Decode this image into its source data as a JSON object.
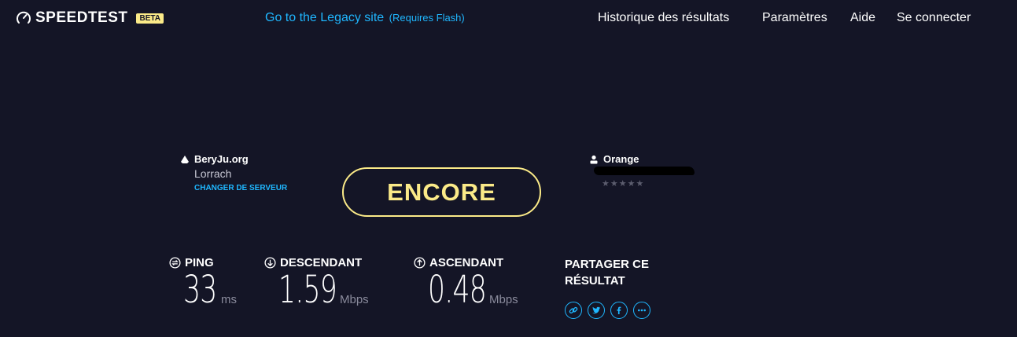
{
  "header": {
    "logo_text": "SPEEDTEST",
    "beta_label": "BETA",
    "legacy_link": "Go to the Legacy site",
    "legacy_note": "(Requires Flash)",
    "nav": {
      "history": "Historique des résultats",
      "settings": "Paramètres",
      "help": "Aide",
      "login": "Se connecter"
    }
  },
  "server": {
    "name": "BeryJu.org",
    "location": "Lorrach",
    "change_label": "CHANGER DE SERVEUR"
  },
  "isp": {
    "name": "Orange",
    "stars": "★★★★★",
    "rating_filled": 0
  },
  "go_button": {
    "label": "ENCORE"
  },
  "results": {
    "ping": {
      "label": "PING",
      "value": "33",
      "unit": "ms"
    },
    "download": {
      "label": "DESCENDANT",
      "value": "1.59",
      "unit": "Mbps"
    },
    "upload": {
      "label": "ASCENDANT",
      "value": "0.48",
      "unit": "Mbps"
    }
  },
  "share": {
    "title": "PARTAGER CE RÉSULTAT",
    "icons": [
      "link-icon",
      "twitter-icon",
      "facebook-icon",
      "more-icon"
    ]
  },
  "colors": {
    "background": "#141526",
    "accent": "#1fb7ff",
    "button": "#fbea88",
    "muted": "#8a8b9c"
  }
}
